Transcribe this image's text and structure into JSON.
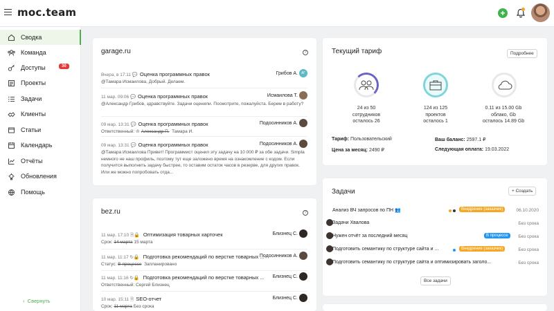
{
  "header": {
    "logo": "moc.team"
  },
  "sidebar": {
    "items": [
      {
        "label": "Сводка",
        "icon": "home-icon"
      },
      {
        "label": "Команда",
        "icon": "team-icon"
      },
      {
        "label": "Доступы",
        "icon": "key-icon",
        "badge": "30"
      },
      {
        "label": "Проекты",
        "icon": "projects-icon"
      },
      {
        "label": "Задачи",
        "icon": "tasks-icon"
      },
      {
        "label": "Клиенты",
        "icon": "clients-icon"
      },
      {
        "label": "Статьи",
        "icon": "articles-icon"
      },
      {
        "label": "Календарь",
        "icon": "calendar-icon"
      },
      {
        "label": "Отчёты",
        "icon": "reports-icon"
      },
      {
        "label": "Обновления",
        "icon": "updates-icon"
      },
      {
        "label": "Помощь",
        "icon": "globe-icon"
      }
    ],
    "collapse": "Свернуть"
  },
  "garage": {
    "title": "garage.ru",
    "rows": [
      {
        "meta": "Вчера, в 17:11",
        "title": "Оценка программных правок",
        "author": "Грибов А.",
        "avatar": "АГ",
        "msg": "@Тамара Исмаилова, Добрый. Делаем."
      },
      {
        "meta": "11 мар. 09:06",
        "title": "Оценка программных правок",
        "author": "Исмаилова Т.",
        "msg": "@Александр Грибов, здравствуйте. Задачи оценили. Посмотрите, пожалуйста. Берем в работу?"
      },
      {
        "meta": "09 мар. 13:31",
        "title": "Оценка программных правок",
        "author": "Подосинников А.",
        "resp_label": "Ответственный:",
        "resp_old": "Александр П.",
        "resp_new": "Тамара И."
      },
      {
        "meta": "09 мар. 13:31",
        "title": "Оценка программных правок",
        "author": "Подосинников А.",
        "msg": "@Тамара Исмаилова Привет! Программист оценил эту задачу на 10 000 ₽ за обе задачи. Simpla немного не наш профиль, поэтому тут еще заложено время на ознакомление с кодом. Если получится выполнить задачу быстрее, то оставим остаток часов в резерве, для других правок. Или же можно попробовать отда..."
      }
    ]
  },
  "bez": {
    "title": "bez.ru",
    "rows": [
      {
        "meta": "11 мар. 17:10",
        "title": "Оптимизация товарных карточек",
        "author": "Близнец С.",
        "label": "Срок:",
        "old": "14 марта",
        "new": "15 марта"
      },
      {
        "meta": "11 мар. 11:17",
        "title": "Подготовка рекомендаций по верстке товарных ...",
        "author": "Подосинников А.",
        "label": "Статус:",
        "old": "В процессе",
        "new": "Запланировано"
      },
      {
        "meta": "11 мар. 11:16",
        "title": "Подготовка рекомендаций по верстке товарных ...",
        "author": "Близнец С.",
        "label": "Ответственный:",
        "old": "",
        "new": "Сергей Близнец"
      },
      {
        "meta": "10 мар. 15:11",
        "title": "SEO-отчет",
        "author": "Близнец С.",
        "label": "Срок:",
        "old": "11 марта",
        "new": "Без срока"
      }
    ]
  },
  "tariff": {
    "title": "Текущий тариф",
    "more": "Подробнее",
    "stats": [
      {
        "line1": "24 из 50",
        "line2": "сотрудников",
        "line3": "осталось 26",
        "icon": "users-icon"
      },
      {
        "line1": "124 из 125",
        "line2": "проектов",
        "line3": "осталось 1",
        "icon": "briefcase-icon"
      },
      {
        "line1": "0.11 из 15.00 Gb",
        "line2": "облако, Gb",
        "line3": "осталось 14.89 Gb",
        "icon": "cloud-icon"
      }
    ],
    "plan_label": "Тариф:",
    "plan": "Пользовательский",
    "balance_label": "Ваш баланс:",
    "balance": "2597.1 ₽",
    "price_label": "Цена за месяц:",
    "price": "2490 ₽",
    "next_label": "Следующая оплата:",
    "next": "19.03.2022"
  },
  "tasks": {
    "title": "Задачи",
    "create": "Создать",
    "all": "Все задачи",
    "items": [
      {
        "title": "Анализ ВЧ запросов по ПН",
        "tag": "Внедрение (заказчик)",
        "date": "06.10.2020"
      },
      {
        "title": "Задачи Хвалова",
        "date": "Без срока"
      },
      {
        "title": "Нужен отчёт за последний месяц",
        "tag": "В процессе",
        "date": "Без срока"
      },
      {
        "title": "Подготовить семантику по структуре сайта и ...",
        "tag": "Внедрение (заказчик)",
        "date": "Без срока"
      },
      {
        "title": "Подготовить семантику по структуре сайта и оптимизировать заголо...",
        "date": "Без срока"
      }
    ]
  },
  "colors": {
    "accent": "#4caf50",
    "badge": "#e53935",
    "tag_orange": "#f5a623",
    "tag_blue": "#2196f3"
  }
}
